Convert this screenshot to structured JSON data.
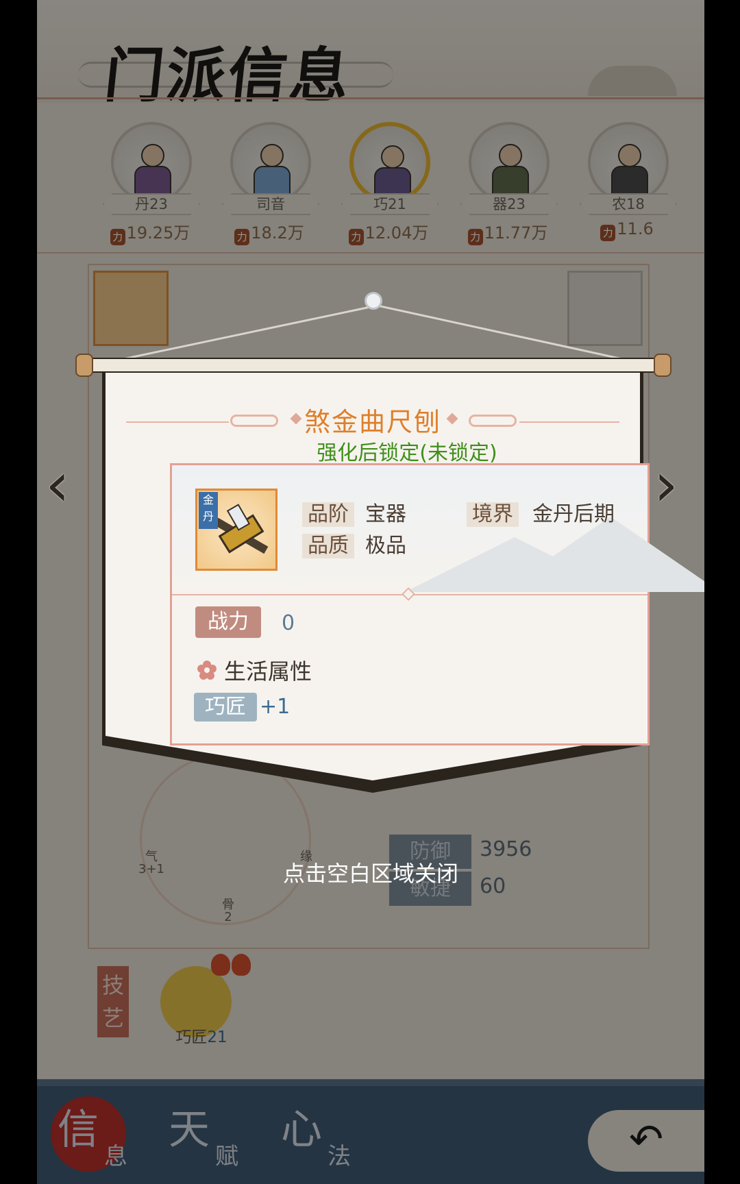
{
  "header": {
    "title": "门派信息"
  },
  "disciples": [
    {
      "name": "丹23",
      "power": "19.25万",
      "active": false,
      "robe": "#7b5a8f"
    },
    {
      "name": "司音",
      "power": "18.2万",
      "active": false,
      "robe": "#7aa6cf"
    },
    {
      "name": "巧21",
      "power": "12.04万",
      "active": true,
      "robe": "#6a5a8e"
    },
    {
      "name": "器23",
      "power": "11.77万",
      "active": false,
      "robe": "#5f6b4a"
    },
    {
      "name": "农18",
      "power": "11.6",
      "active": false,
      "robe": "#4b4b4b"
    }
  ],
  "modal": {
    "item_name": "煞金曲尺刨",
    "lock_status": "强化后锁定(未锁定)",
    "icon_tag": "金丹",
    "grade_label": "品阶",
    "grade_value": "宝器",
    "realm_label": "境界",
    "realm_value": "金丹后期",
    "quality_label": "品质",
    "quality_value": "极品",
    "power_label": "战力",
    "power_value": "0",
    "life_attr_title": "生活属性",
    "craft_label": "巧匠",
    "craft_value": "+1",
    "close_hint": "点击空白区域关闭"
  },
  "background": {
    "radar": {
      "qi": "气",
      "qi_val": "3+1",
      "gu": "骨",
      "gu_val": "2",
      "yuan": "缘"
    },
    "stats": [
      {
        "label": "防御",
        "value": "3956"
      },
      {
        "label": "敏捷",
        "value": "60"
      }
    ],
    "skills_tab": "技艺",
    "skill": {
      "name": "巧匠",
      "level": "21"
    }
  },
  "nav": {
    "tabs": [
      {
        "big": "信",
        "small": "息",
        "active": true
      },
      {
        "big": "天",
        "small": "赋",
        "active": false
      },
      {
        "big": "心",
        "small": "法",
        "active": false
      }
    ]
  },
  "colors": {
    "accent_orange": "#de7f2a",
    "lock_green": "#3f8f1a",
    "nav_blue": "#3f5a72"
  }
}
